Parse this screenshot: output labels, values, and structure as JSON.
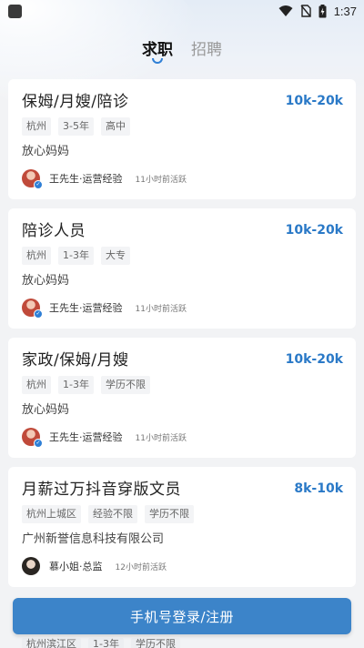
{
  "status_bar": {
    "time": "1:37"
  },
  "tabs": [
    {
      "label": "求职",
      "active": true
    },
    {
      "label": "招聘",
      "active": false
    }
  ],
  "jobs": [
    {
      "title": "保姆/月嫂/陪诊",
      "salary": "10k-20k",
      "tags": [
        "杭州",
        "3-5年",
        "高中"
      ],
      "company": "放心妈妈",
      "recruiter": "王先生·运营经验",
      "active": "11小时前活跃"
    },
    {
      "title": "陪诊人员",
      "salary": "10k-20k",
      "tags": [
        "杭州",
        "1-3年",
        "大专"
      ],
      "company": "放心妈妈",
      "recruiter": "王先生·运营经验",
      "active": "11小时前活跃"
    },
    {
      "title": "家政/保姆/月嫂",
      "salary": "10k-20k",
      "tags": [
        "杭州",
        "1-3年",
        "学历不限"
      ],
      "company": "放心妈妈",
      "recruiter": "王先生·运营经验",
      "active": "11小时前活跃"
    },
    {
      "title": "月薪过万抖音穿版文员",
      "salary": "8k-10k",
      "tags": [
        "杭州上城区",
        "经验不限",
        "学历不限"
      ],
      "company": "广州新誉信息科技有限公司",
      "recruiter": "慕小姐·总监",
      "active": "12小时前活跃"
    }
  ],
  "peek_tags": [
    "杭州滨江区",
    "1-3年",
    "学历不限"
  ],
  "login_button": {
    "label": "手机号登录/注册"
  },
  "colors": {
    "accent": "#2a79c7",
    "button": "#3c84c9"
  }
}
